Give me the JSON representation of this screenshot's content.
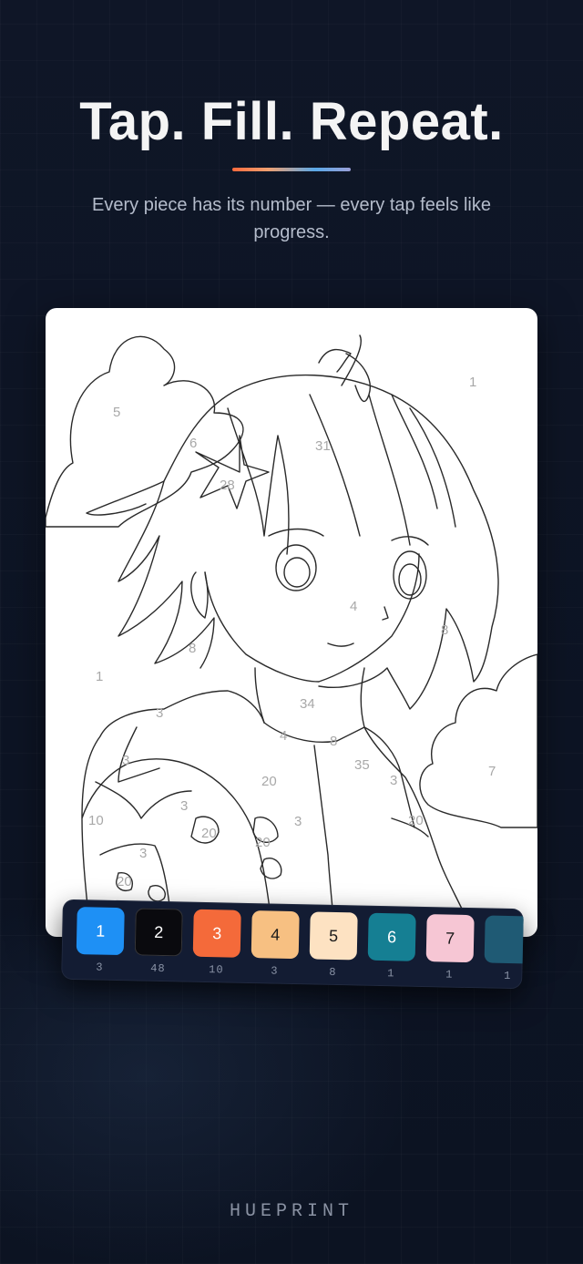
{
  "header": {
    "title": "Tap. Fill. Repeat.",
    "subtitle": "Every piece has its number — every tap feels like progress."
  },
  "colors": {
    "background": "#0d1424",
    "accent_gradient": [
      "#ff6b3d",
      "#f0a070",
      "#5aa8e8",
      "#9aa0d8"
    ],
    "card": "#ffffff"
  },
  "artwork": {
    "region_numbers": [
      "1",
      "5",
      "6",
      "31",
      "28",
      "4",
      "8",
      "8",
      "1",
      "34",
      "4",
      "3",
      "3",
      "8",
      "35",
      "3",
      "7",
      "20",
      "20",
      "3",
      "10",
      "3",
      "20",
      "20",
      "3",
      "20"
    ]
  },
  "palette": {
    "swatches": [
      {
        "number": "1",
        "count": "3",
        "color": "#1e90f5",
        "text_color": "#ffffff"
      },
      {
        "number": "2",
        "count": "48",
        "color": "#0a0a0e",
        "text_color": "#ffffff"
      },
      {
        "number": "3",
        "count": "10",
        "color": "#f46a3a",
        "text_color": "#ffffff"
      },
      {
        "number": "4",
        "count": "3",
        "color": "#f7c082",
        "text_color": "#1a1a1a"
      },
      {
        "number": "5",
        "count": "8",
        "color": "#fde2c2",
        "text_color": "#1a1a1a"
      },
      {
        "number": "6",
        "count": "1",
        "color": "#157f93",
        "text_color": "#ffffff"
      },
      {
        "number": "7",
        "count": "1",
        "color": "#f6c6d4",
        "text_color": "#1a1a1a"
      },
      {
        "number": "",
        "count": "1",
        "color": "#1f5a74",
        "text_color": "#ffffff"
      }
    ]
  },
  "footer": {
    "brand": "HUEPRINT"
  }
}
